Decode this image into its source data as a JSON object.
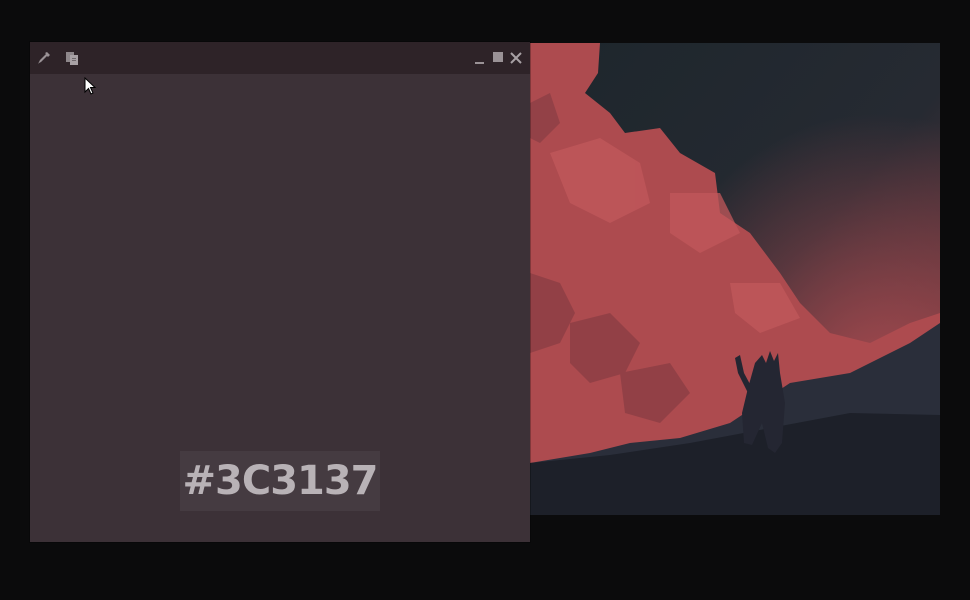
{
  "picker": {
    "hex_value": "#3C3137",
    "swatch_color": "#3c3137",
    "titlebar_color": "#2e2328",
    "toolbar": {
      "eyedropper_icon": "eyedropper-icon",
      "copy_icon": "copy-icon",
      "minimize_icon": "minimize-icon",
      "maximize_icon": "maximize-icon",
      "close_icon": "close-icon"
    }
  },
  "artwork": {
    "sky_color": "#1f272d",
    "cloud_color": "#b04a4d",
    "ground_color": "#1a1d24"
  }
}
